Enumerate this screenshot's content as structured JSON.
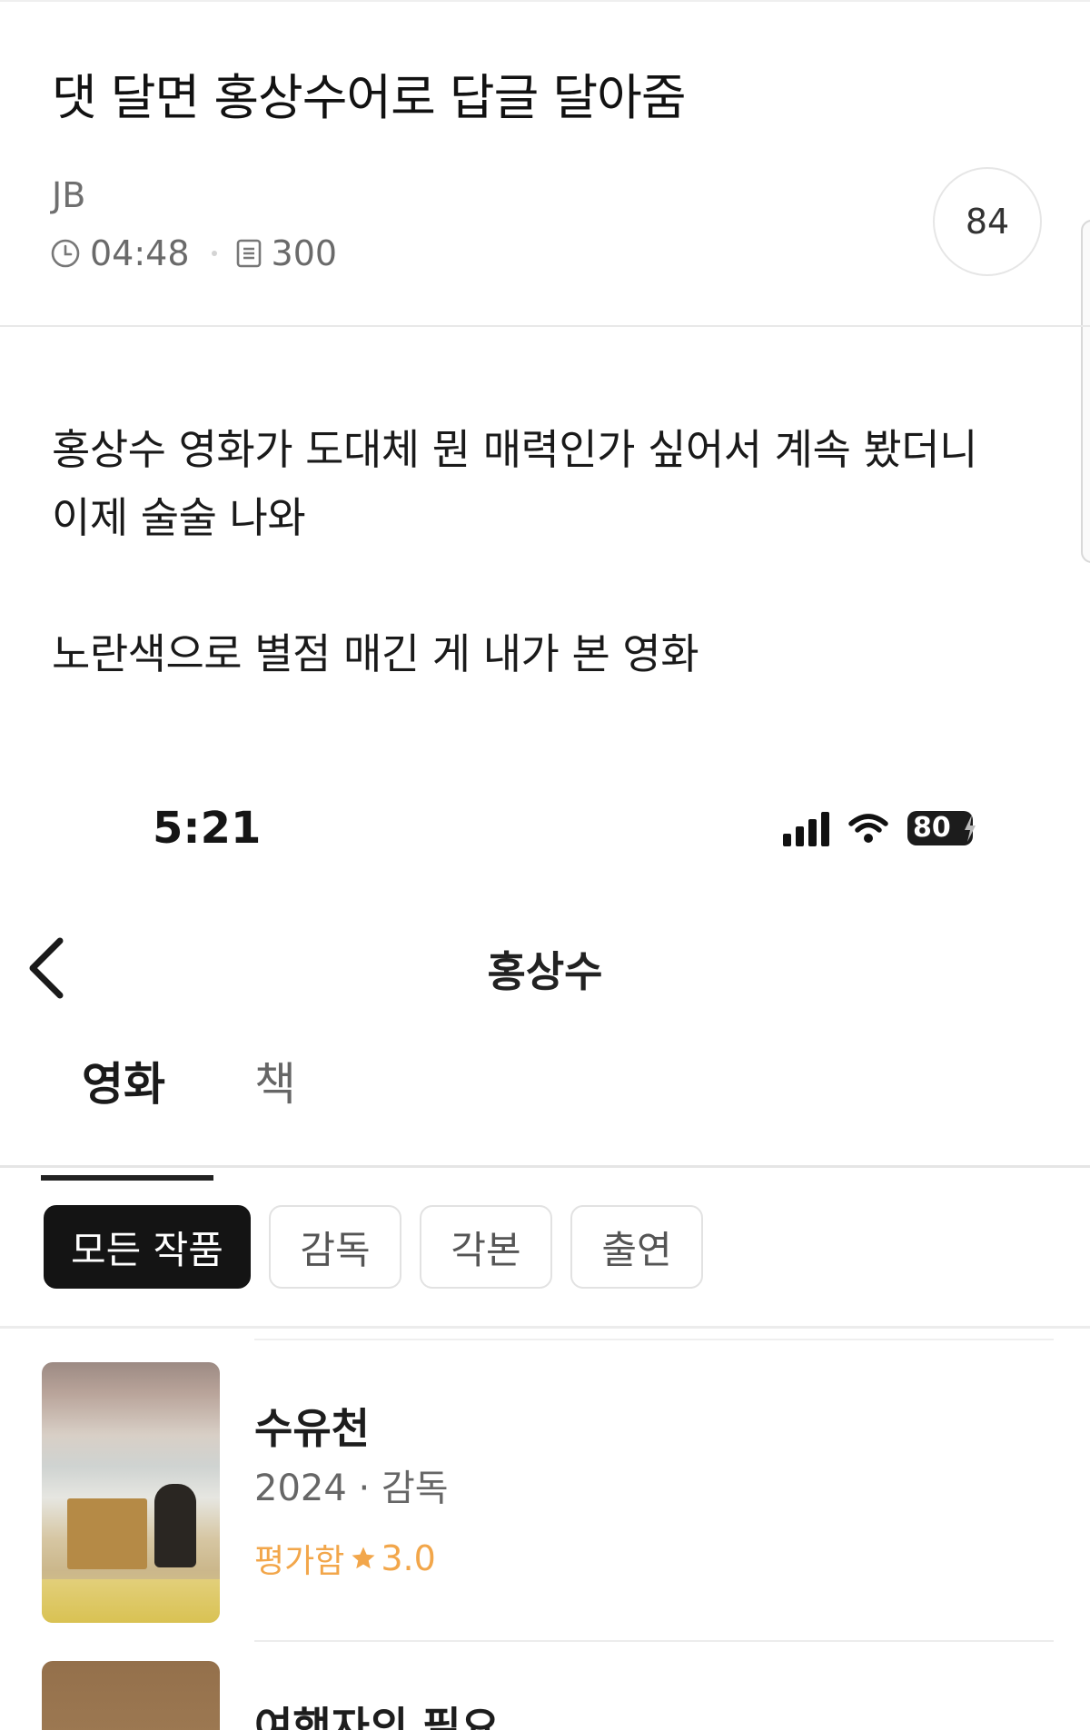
{
  "post": {
    "title": "댓 달면 홍상수어로 답글 달아줌",
    "author": "JB",
    "time": "04:48",
    "views": "300",
    "comment_count": "84",
    "body_line1": "홍상수 영화가 도대체 뭔 매력인가 싶어서 계속 봤더니",
    "body_line2": "이제 술술 나와",
    "body_line3": "노란색으로 별점 매긴 게 내가 본 영화"
  },
  "screenshot": {
    "status_time": "5:21",
    "battery": "80",
    "nav_title": "홍상수",
    "tabs": [
      {
        "label": "영화",
        "active": true
      },
      {
        "label": "책",
        "active": false
      }
    ],
    "filters": [
      {
        "label": "모든 작품",
        "active": true
      },
      {
        "label": "감독",
        "active": false
      },
      {
        "label": "각본",
        "active": false
      },
      {
        "label": "출연",
        "active": false
      }
    ],
    "movies": [
      {
        "title": "수유천",
        "meta": "2024 · 감독",
        "rating_label": "평가함",
        "rating": "3.0"
      },
      {
        "title": "여행자의 필요"
      }
    ],
    "rating_color": "#f2a64a"
  }
}
